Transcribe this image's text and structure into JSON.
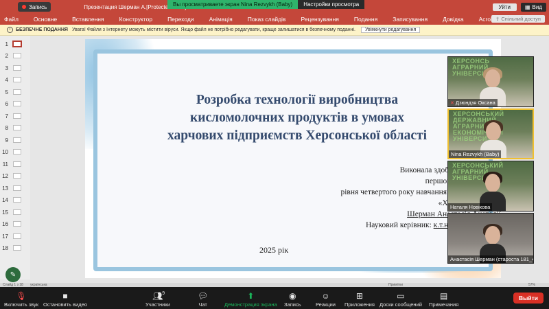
{
  "titlebar": {
    "recording_label": "Запись",
    "window_title": "Презентация Шерман А.[Protected View] - Pow",
    "share_message": "Вы просматриваете экран Nina Rezvykh (Baby)",
    "share_options": "Настройки просмотра",
    "leave_label": "Уйти",
    "view_label": "Вид"
  },
  "ribbon": {
    "tabs": [
      "Файл",
      "Основне",
      "Вставлення",
      "Конструктор",
      "Переходи",
      "Анімація",
      "Показ слайдів",
      "Рецензування",
      "Подання",
      "Записування",
      "Довідка",
      "Acrobat"
    ],
    "share_access": "Спільний доступ"
  },
  "protected_view": {
    "title": "БЕЗПЕЧНЕ ПОДАННЯ",
    "message": "Увага! Файли з Інтернету можуть містити віруси. Якщо файл не потрібно редагувати, краще залишатися в безпечному поданні.",
    "enable_button": "Увімкнути редагування"
  },
  "thumbnails": {
    "numbers": [
      "1",
      "2",
      "3",
      "4",
      "5",
      "6",
      "7",
      "8",
      "9",
      "10",
      "11",
      "12",
      "13",
      "14",
      "15",
      "16",
      "17",
      "18"
    ],
    "selected": "1"
  },
  "slide": {
    "title_line1": "Розробка технології виробництва",
    "title_line2": "кисломолочних продуктів в умовах",
    "title_line3": "харчових підприємств Херсонської області",
    "info_line1": "Виконала здобувач вищої осві",
    "info_line2": "першого(бакалаврсько",
    "info_line3": "рівня четвертого року навчання спеціальності 1",
    "info_line4": "«Харчові технолог",
    "info_line5": "Шерман Анастасія Анатолії",
    "info_line6_prefix": "Науковий керівник: ",
    "info_line6_link": "к.т.н., доц. Резвих Н",
    "year": "2025 рік"
  },
  "statusbar": {
    "slide_counter": "Слайд 1 з 18",
    "language": "українська",
    "notes": "Примітки",
    "zoom": "57%"
  },
  "participants_video": [
    {
      "name": "Дзюндзя Оксана",
      "muted": true,
      "active": false,
      "wall": [
        "ХЕРСОНСЬ",
        "АГРАРНИЙ",
        "УНІВЕРСИ"
      ]
    },
    {
      "name": "Nina Rezvykh (Baby)",
      "muted": false,
      "active": true,
      "wall": [
        "ХЕРСОНСЬКИЙ ДЕРЖАВНИЙ",
        "АГРАРНИЙ ЕКОНОМІЧНИЙ",
        "УНІВЕРСИТЕТ"
      ]
    },
    {
      "name": "Наталя Новікова",
      "muted": false,
      "active": false,
      "wall": [
        "ХЕРСОНСЬКИЙ",
        "АГРАРНИЙ",
        "УНІВЕРСИТЕТ"
      ]
    },
    {
      "name": "Анастасія Шерман (староста 181_4...",
      "muted": false,
      "active": false,
      "wall": []
    }
  ],
  "toolbar": {
    "unmute_label": "Включить звук",
    "video_label": "Остановить видео",
    "participants_label": "Участники",
    "participants_count": "9",
    "chat_label": "Чат",
    "share_label": "Демонстрация экрана",
    "record_label": "Запись",
    "reactions_label": "Реакции",
    "apps_label": "Приложения",
    "whiteboard_label": "Доски сообщений",
    "notes_label": "Примечания",
    "leave_label": "Выйти"
  },
  "colors": {
    "ribbon": "#c4473a",
    "share_banner": "#2fb36b",
    "title_text": "#354b6e",
    "leave_button": "#d93025",
    "active_speaker": "#f0c030"
  }
}
